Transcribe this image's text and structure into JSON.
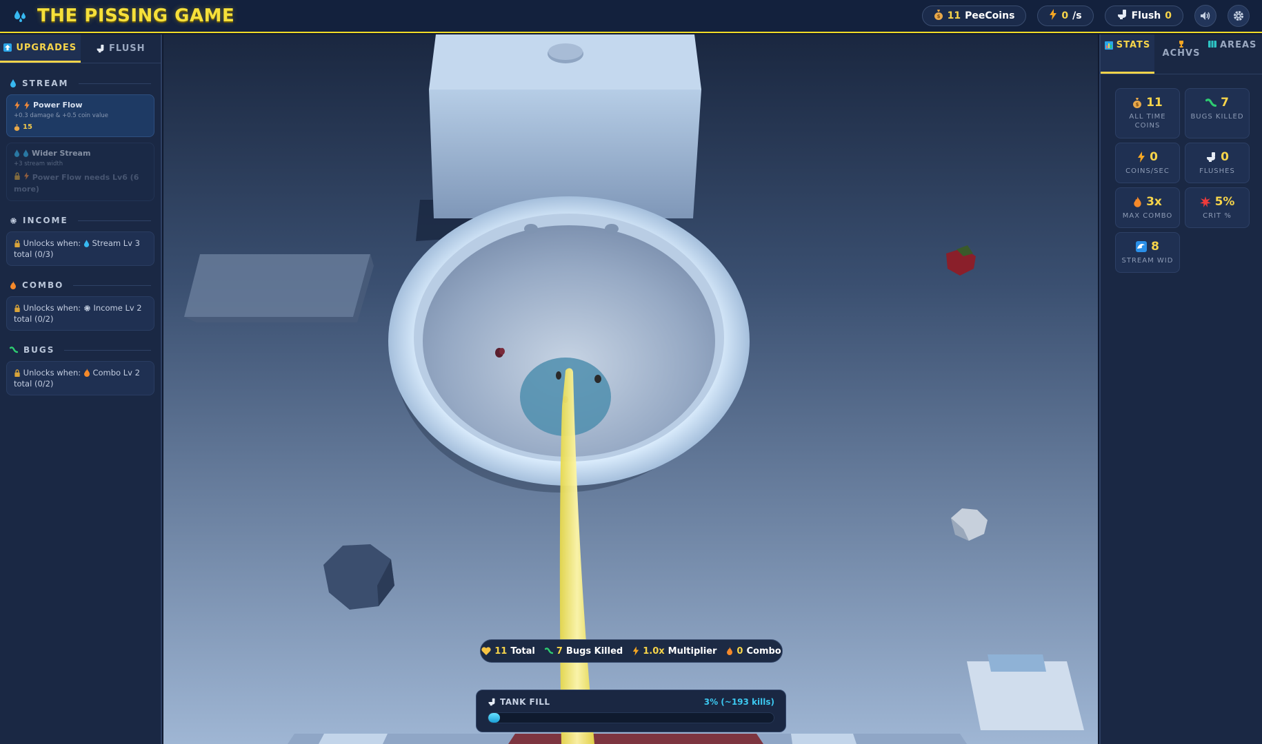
{
  "header": {
    "title": "THE PISSING GAME",
    "coins_value": "11",
    "coins_label": "PeeCoins",
    "rate_value": "0",
    "rate_label": "/s",
    "flush_label": "Flush",
    "flush_value": "0"
  },
  "left_panel": {
    "tabs": [
      {
        "label": "UPGRADES",
        "icon": "upgrade-arrow-icon",
        "active": true
      },
      {
        "label": "FLUSH",
        "icon": "toilet-icon",
        "active": false
      }
    ],
    "sections": {
      "stream": {
        "title": "STREAM",
        "upgrades": [
          {
            "name": "Power Flow",
            "desc": "+0.3 damage & +0.5 coin value",
            "cost": "15"
          },
          {
            "name": "Wider Stream",
            "desc": "+3 stream width",
            "lock_text": "Power Flow needs Lv6 (6 more)"
          }
        ]
      },
      "income": {
        "title": "INCOME",
        "unlock_prefix": "Unlocks when:",
        "unlock_req": "Stream Lv 3",
        "unlock_total": "total (0/3)"
      },
      "combo": {
        "title": "COMBO",
        "unlock_prefix": "Unlocks when:",
        "unlock_req": "Income Lv 2",
        "unlock_total": "total (0/2)"
      },
      "bugs": {
        "title": "BUGS",
        "unlock_prefix": "Unlocks when:",
        "unlock_req": "Combo Lv 2",
        "unlock_total": "total (0/2)"
      }
    }
  },
  "right_panel": {
    "tabs": [
      {
        "label": "STATS",
        "icon": "chart-icon",
        "active": true
      },
      {
        "label": "ACHVS",
        "icon": "trophy-icon",
        "active": false
      },
      {
        "label": "AREAS",
        "icon": "map-icon",
        "active": false
      }
    ],
    "stats": [
      {
        "value": "11",
        "label": "ALL TIME COINS",
        "icon": "money-bag-icon"
      },
      {
        "value": "7",
        "label": "BUGS KILLED",
        "icon": "worm-icon"
      },
      {
        "value": "0",
        "label": "COINS/SEC",
        "icon": "lightning-icon"
      },
      {
        "value": "0",
        "label": "FLUSHES",
        "icon": "toilet-icon"
      },
      {
        "value": "3x",
        "label": "MAX COMBO",
        "icon": "fire-icon"
      },
      {
        "value": "5%",
        "label": "CRIT %",
        "icon": "burst-icon"
      },
      {
        "value": "8",
        "label": "STREAM WID",
        "icon": "wave-icon"
      }
    ]
  },
  "hud": {
    "total_value": "11",
    "total_label": "Total",
    "bugs_value": "7",
    "bugs_label": "Bugs Killed",
    "mult_value": "1.0x",
    "mult_label": "Multiplier",
    "combo_value": "0",
    "combo_label": "Combo"
  },
  "tank": {
    "label": "TANK FILL",
    "pct_text": "3% (~193 kills)",
    "fill_fraction": 0.03
  },
  "colors": {
    "accent": "#f6d44a",
    "panel": "#1a2844",
    "stream": "#f7ee7a",
    "water": "#3cc8f0"
  }
}
